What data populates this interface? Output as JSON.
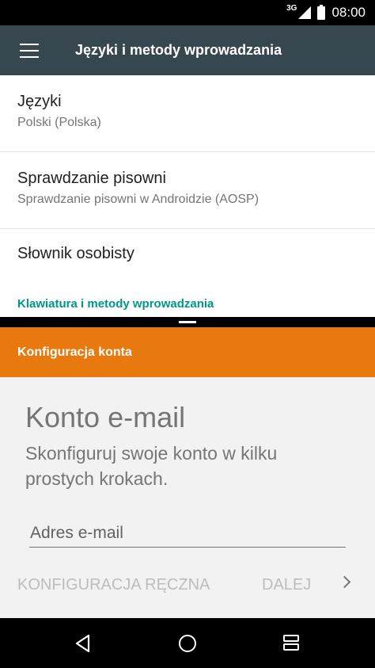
{
  "status_bar": {
    "network": "3G",
    "time": "08:00"
  },
  "toolbar": {
    "title": "Języki i metody wprowadzania"
  },
  "settings": {
    "items": [
      {
        "title": "Języki",
        "summary": "Polski (Polska)"
      },
      {
        "title": "Sprawdzanie pisowni",
        "summary": "Sprawdzanie pisowni w Androidzie (AOSP)"
      },
      {
        "title": "Słownik osobisty"
      }
    ],
    "section_header": "Klawiatura i metody wprowadzania"
  },
  "email_setup": {
    "header": "Konfiguracja konta",
    "title": "Konto e-mail",
    "description": "Skonfiguruj swoje konto w kilku prostych krokach.",
    "email_placeholder": "Adres e-mail",
    "manual_setup_label": "KONFIGURACJA RĘCZNA",
    "next_label": "DALEJ"
  },
  "colors": {
    "toolbar": "#37474f",
    "accent_orange": "#e8790f",
    "section_teal": "#009688"
  },
  "icons": {
    "menu": "menu-icon",
    "next": "chevron-right-icon",
    "back": "back-triangle-icon",
    "home": "home-circle-icon",
    "recents": "recents-icon"
  }
}
